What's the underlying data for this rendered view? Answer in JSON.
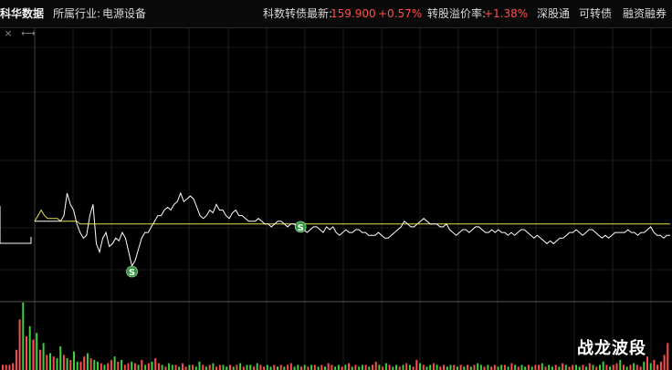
{
  "header": {
    "stock_name": "科华数据",
    "industry_label": "所属行业:",
    "industry_value": "电源设备",
    "bond_label": "科数转债最新:",
    "bond_price": "159.900",
    "bond_change": "+0.57%",
    "premium_label": "转股溢价率:",
    "premium_value": "+1.38%",
    "links": [
      "深股通",
      "可转债",
      "融资融券"
    ]
  },
  "toolbar": {
    "close_glyph": "×",
    "expand_glyph": "⟷"
  },
  "signals": [
    {
      "label": "S",
      "index": 30
    },
    {
      "label": "S",
      "index": 82
    }
  ],
  "watermark": "战龙波段",
  "colors": {
    "price_line": "#ffffff",
    "avg_line": "#e8e04a",
    "grid": "#333333",
    "up_volume": "#ff4d4d",
    "down_volume": "#3fcf3f",
    "signal_badge": "#2e9a3e",
    "accent_red": "#ff4d4d"
  },
  "chart_data": {
    "type": "line",
    "series": [
      {
        "values": [
          56,
          56,
          56,
          56,
          56,
          56,
          56,
          56,
          56,
          58,
          66,
          62,
          60,
          55,
          52,
          50,
          51,
          58,
          62,
          48,
          45,
          50,
          52,
          47,
          48,
          50,
          49,
          52,
          50,
          45,
          40,
          42,
          46,
          50,
          52,
          52,
          54,
          56,
          58,
          58,
          60,
          61,
          60,
          62,
          63,
          66,
          63,
          64,
          65,
          64,
          61,
          58,
          57,
          58,
          60,
          59,
          62,
          60,
          60,
          58,
          57,
          59,
          60,
          58,
          58,
          57,
          56,
          56,
          56,
          57,
          56,
          55,
          55,
          54,
          55,
          56,
          56,
          55,
          54,
          55,
          55,
          54,
          54,
          53,
          52,
          53,
          54,
          54,
          53,
          52,
          54,
          53,
          54,
          52,
          51,
          52,
          53,
          52,
          52,
          53,
          53,
          52,
          52,
          51,
          51,
          51,
          52,
          51,
          50,
          50,
          51,
          52,
          53,
          54,
          56,
          55,
          54,
          54,
          55,
          56,
          57,
          56,
          55,
          55,
          55,
          54,
          54,
          55,
          53,
          52,
          51,
          52,
          53,
          53,
          52,
          53,
          54,
          54,
          53,
          52,
          52,
          53,
          52,
          53,
          52,
          52,
          51,
          52,
          51,
          52,
          53,
          53,
          52,
          51,
          50,
          51,
          50,
          49,
          48,
          49,
          48,
          49,
          50,
          50,
          51,
          52,
          52,
          53,
          52,
          51,
          52,
          53,
          53,
          52,
          51,
          50,
          51,
          50,
          51,
          52,
          52,
          52,
          52,
          53,
          52,
          52,
          51,
          52,
          52,
          53,
          54,
          52,
          51,
          51,
          50,
          51,
          51
        ]
      },
      {
        "values": [
          56,
          58,
          60,
          58,
          57,
          57,
          57,
          57,
          56,
          56,
          56,
          56,
          56,
          56,
          55,
          55,
          55,
          55,
          55,
          55,
          55,
          55,
          55,
          55,
          55,
          55,
          55,
          55,
          55,
          55,
          55,
          55,
          55,
          55,
          55,
          55,
          55,
          55,
          55,
          55,
          55,
          55,
          55,
          55,
          55,
          55,
          55,
          55,
          55,
          55,
          55,
          55,
          55,
          55,
          55,
          55,
          55,
          55,
          55,
          55,
          55,
          55,
          55,
          55,
          55,
          55,
          55,
          55,
          55,
          55,
          55,
          55,
          55,
          55,
          55,
          55,
          55,
          55,
          55,
          55,
          55,
          55,
          55,
          55,
          55,
          55,
          55,
          55,
          55,
          55,
          55,
          55,
          55,
          55,
          55,
          55,
          55,
          55,
          55,
          55,
          55,
          55,
          55,
          55,
          55,
          55,
          55,
          55,
          55,
          55,
          55,
          55,
          55,
          55,
          55,
          55,
          55,
          55,
          55,
          55,
          55,
          55,
          55,
          55,
          55,
          55,
          55,
          55,
          55,
          55,
          55,
          55,
          55,
          55,
          55,
          55,
          55,
          55,
          55,
          55,
          55,
          55,
          55,
          55,
          55,
          55,
          55,
          55,
          55,
          55,
          55,
          55,
          55,
          55,
          55,
          55,
          55,
          55,
          55,
          55,
          55,
          55,
          55,
          55,
          55,
          55,
          55,
          55,
          55,
          55,
          55,
          55,
          55,
          55,
          55,
          55,
          55,
          55,
          55,
          55,
          55,
          55,
          55,
          55,
          55,
          55,
          55,
          55,
          55,
          55,
          55,
          55,
          55,
          55,
          55,
          55,
          55
        ]
      }
    ],
    "volume": {
      "values": [
        3,
        3,
        3,
        4,
        12,
        30,
        40,
        20,
        26,
        18,
        22,
        12,
        16,
        9,
        10,
        8,
        7,
        14,
        9,
        7,
        6,
        11,
        5,
        5,
        8,
        10,
        7,
        6,
        5,
        4,
        3,
        4,
        6,
        8,
        5,
        6,
        3,
        4,
        5,
        4,
        3,
        6,
        3,
        4,
        5,
        7,
        4,
        3,
        2,
        4,
        3,
        3,
        2,
        4,
        2,
        3,
        3,
        2,
        5,
        3,
        2,
        3,
        4,
        2,
        3,
        3,
        2,
        3,
        2,
        3,
        4,
        2,
        3,
        3,
        2,
        4,
        3,
        2,
        3,
        2,
        3,
        2,
        3,
        2,
        3,
        4,
        2,
        3,
        2,
        3,
        2,
        3,
        3,
        2,
        3,
        2,
        4,
        3,
        2,
        3,
        2,
        3,
        4,
        2,
        3,
        2,
        3,
        3,
        2,
        3,
        5,
        3,
        2,
        4,
        3,
        2,
        3,
        2,
        3,
        4,
        3,
        2,
        6,
        4,
        3,
        2,
        3,
        4,
        3,
        2,
        3,
        2,
        3,
        3,
        2,
        3,
        2,
        3,
        2,
        3,
        4,
        3,
        2,
        3,
        2,
        3,
        2,
        3,
        3,
        2,
        4,
        3,
        2,
        3,
        2,
        3,
        2,
        3,
        3,
        4,
        2,
        3,
        2,
        3,
        2,
        4,
        3,
        2,
        3,
        3,
        2,
        3,
        2,
        4,
        3,
        2,
        3,
        5,
        3,
        2,
        3,
        4,
        6,
        3,
        2,
        3,
        4,
        3,
        2,
        5,
        8,
        4,
        6,
        3,
        5,
        9,
        16
      ],
      "up": [
        1,
        1,
        1,
        1,
        1,
        1,
        0,
        1,
        0,
        1,
        0,
        1,
        0,
        1,
        0,
        1,
        0,
        0,
        1,
        0,
        1,
        0,
        0,
        1,
        1,
        0,
        1,
        0,
        0,
        1,
        0,
        1,
        1,
        0,
        1,
        0,
        1,
        1,
        0,
        1,
        0,
        1,
        0,
        1,
        0,
        1,
        1,
        0,
        1,
        0,
        0,
        1,
        0,
        1,
        1,
        0,
        1,
        0,
        0,
        1,
        0,
        1,
        0,
        1,
        1,
        0,
        0,
        1,
        0,
        1,
        0,
        1,
        0,
        0,
        1,
        0,
        1,
        1,
        0,
        0,
        1,
        0,
        1,
        0,
        1,
        1,
        0,
        0,
        1,
        0,
        1,
        0,
        1,
        0,
        1,
        0,
        1,
        1,
        0,
        0,
        1,
        0,
        1,
        0,
        1,
        0,
        0,
        1,
        0,
        1,
        1,
        0,
        1,
        0,
        1,
        0,
        0,
        1,
        0,
        1,
        0,
        1,
        1,
        0,
        1,
        0,
        0,
        1,
        0,
        1,
        1,
        0,
        0,
        1,
        0,
        1,
        0,
        1,
        0,
        1,
        0,
        0,
        1,
        0,
        1,
        1,
        0,
        0,
        1,
        0,
        1,
        0,
        1,
        0,
        0,
        1,
        0,
        1,
        1,
        0,
        1,
        0,
        0,
        1,
        0,
        1,
        0,
        1,
        1,
        0,
        0,
        1,
        0,
        1,
        0,
        1,
        0,
        0,
        1,
        0,
        1,
        1,
        0,
        1,
        0,
        1,
        0,
        1,
        1,
        0,
        1,
        0,
        1,
        1,
        1,
        1,
        1
      ]
    }
  }
}
